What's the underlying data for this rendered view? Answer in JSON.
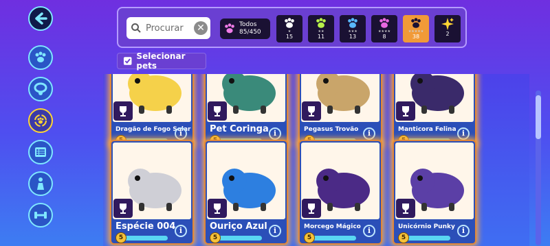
{
  "search": {
    "placeholder": "Procurar"
  },
  "filter_all": {
    "label": "Todos",
    "count": "85/450"
  },
  "rarity_filters": [
    {
      "stars": "★",
      "count": "15",
      "paw_color": "#ffffff",
      "selected": false
    },
    {
      "stars": "★★",
      "count": "11",
      "paw_color": "#b7f04a",
      "selected": false
    },
    {
      "stars": "★★★",
      "count": "13",
      "paw_color": "#59b8ff",
      "selected": false
    },
    {
      "stars": "★★★★",
      "count": "8",
      "paw_color": "#e868e0",
      "selected": false
    },
    {
      "stars": "★★★★★",
      "count": "38",
      "paw_color": "#1a1133",
      "selected": true
    },
    {
      "stars": "",
      "count": "2",
      "paw_color": "#ffd633",
      "selected": false
    }
  ],
  "select_pets_label": "Selecionar pets",
  "sidebar": {
    "items": [
      {
        "name": "pets-paw-icon"
      },
      {
        "name": "collar-icon"
      },
      {
        "name": "paw-cycle-icon",
        "active": true
      },
      {
        "name": "list-icon"
      },
      {
        "name": "trainer-icon"
      },
      {
        "name": "dumbbell-icon"
      }
    ]
  },
  "pets": [
    {
      "name": "Dragão de Fogo Solar",
      "level": "5",
      "progress": 1.0,
      "art_color": "#f5d14a"
    },
    {
      "name": "Pet Coringa",
      "level": "5",
      "progress": 1.0,
      "art_color": "#3a8a7a"
    },
    {
      "name": "Pegasus Trovão",
      "level": "5",
      "progress": 1.0,
      "art_color": "#c9a56a"
    },
    {
      "name": "Manticora Felina",
      "level": "5",
      "progress": 1.0,
      "art_color": "#3a2a6a"
    },
    {
      "name": "Espécie 004",
      "level": "5",
      "progress": 1.0,
      "art_color": "#cfcfd6"
    },
    {
      "name": "Ouriço Azul",
      "level": "5",
      "progress": 1.0,
      "art_color": "#2d7fe0"
    },
    {
      "name": "Morcego Mágico",
      "level": "5",
      "progress": 1.0,
      "art_color": "#4b2a86"
    },
    {
      "name": "Unicórnio Punky",
      "level": "5",
      "progress": 1.0,
      "art_color": "#5b3fa6"
    }
  ],
  "colors": {
    "accent_orange": "#f19a38",
    "panel_purple": "#6a3fd2",
    "bar_cyan": "#59d7f2"
  }
}
